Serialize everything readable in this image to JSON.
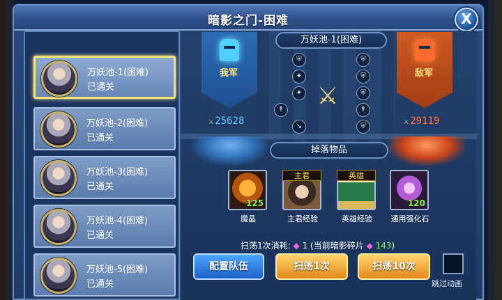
{
  "window": {
    "title": "暗影之门-困难"
  },
  "close_button": {
    "glyph": "X"
  },
  "levels": [
    {
      "name": "万妖池-1(困难)",
      "status": "已通关",
      "selected": true
    },
    {
      "name": "万妖池-2(困难)",
      "status": "已通关",
      "selected": false
    },
    {
      "name": "万妖池-3(困难)",
      "status": "已通关",
      "selected": false
    },
    {
      "name": "万妖池-4(困难)",
      "status": "已通关",
      "selected": false
    },
    {
      "name": "万妖池-5(困难)",
      "status": "已通关",
      "selected": false
    }
  ],
  "battle": {
    "stage_name": "万妖池-1(困难)",
    "ally_label": "我军",
    "enemy_label": "敌军",
    "ally_power": "25628",
    "enemy_power": "29119"
  },
  "drops": {
    "label": "掉落物品",
    "items": [
      {
        "name": "魔晶",
        "count": "125",
        "tag": ""
      },
      {
        "name": "主君经验",
        "count": "",
        "tag": "主君"
      },
      {
        "name": "英雄经验",
        "count": "",
        "tag": "英雄"
      },
      {
        "name": "通用强化石",
        "count": "120",
        "tag": ""
      }
    ]
  },
  "sweep": {
    "cost_label": "扫荡1次消耗:",
    "cost_value": "1",
    "current_prefix": "(当前暗影碎片",
    "current_value": "143",
    "current_suffix": ")"
  },
  "buttons": {
    "configure": "配置队伍",
    "sweep_once": "扫荡1次",
    "sweep_ten": "扫荡10次",
    "skip_animation": "跳过动画"
  },
  "colors": {
    "ally": "#5fc7ff",
    "enemy": "#ff7a3a",
    "count_green": "#8af04c",
    "selected_border": "#f2e27a"
  }
}
